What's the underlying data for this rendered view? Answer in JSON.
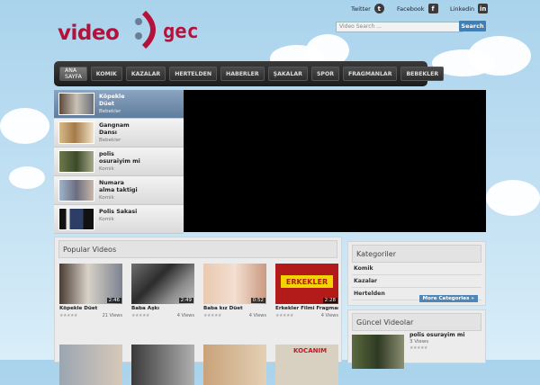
{
  "logo": {
    "word1": "video",
    "word2": "gec"
  },
  "social": {
    "twitter": "Twitter",
    "facebook": "Facebook",
    "linkedin": "Linkedin"
  },
  "search": {
    "placeholder": "Video Search ...",
    "button": "Search"
  },
  "nav": [
    "ANA SAYFA",
    "KOMIK",
    "KAZALAR",
    "HERTELDEN",
    "HABERLER",
    "ŞAKALAR",
    "SPOR",
    "FRAGMANLAR",
    "BEBEKLER"
  ],
  "featured": [
    {
      "title": "Köpekle Düet",
      "category": "Bebekler"
    },
    {
      "title": "Gangnam Dansı",
      "category": "Bebekler"
    },
    {
      "title": "polis osuraiyim mi",
      "category": "Komik"
    },
    {
      "title": "Numara alma taktigi",
      "category": "Komik"
    },
    {
      "title": "Polis Sakasi",
      "category": "Komik"
    }
  ],
  "popular": {
    "heading": "Popular Videos",
    "videos": [
      {
        "title": "Köpekle Düet",
        "duration": "2:46",
        "views": "21 Views"
      },
      {
        "title": "Baba Aşkı",
        "duration": "2:49",
        "views": "4 Views"
      },
      {
        "title": "Baba kız Düet",
        "duration": "0:52",
        "views": "4 Views"
      },
      {
        "title": "Erkekler Filmi Fragmanı",
        "duration": "2:28",
        "views": "4 Views"
      }
    ],
    "poster_text": {
      "erkekler": "ERKEKLER",
      "kocanim": "KOCANIM"
    }
  },
  "categories": {
    "heading": "Kategoriler",
    "items": [
      "Komik",
      "Kazalar",
      "Hertelden"
    ],
    "more": "More Categories »"
  },
  "recent": {
    "heading": "Güncel Videolar",
    "title": "polis osurayim mi",
    "views": "3 Views"
  },
  "colors": {
    "brand": "#b5123b",
    "nav_bg": "#222222",
    "accent": "#3e7fb6"
  }
}
